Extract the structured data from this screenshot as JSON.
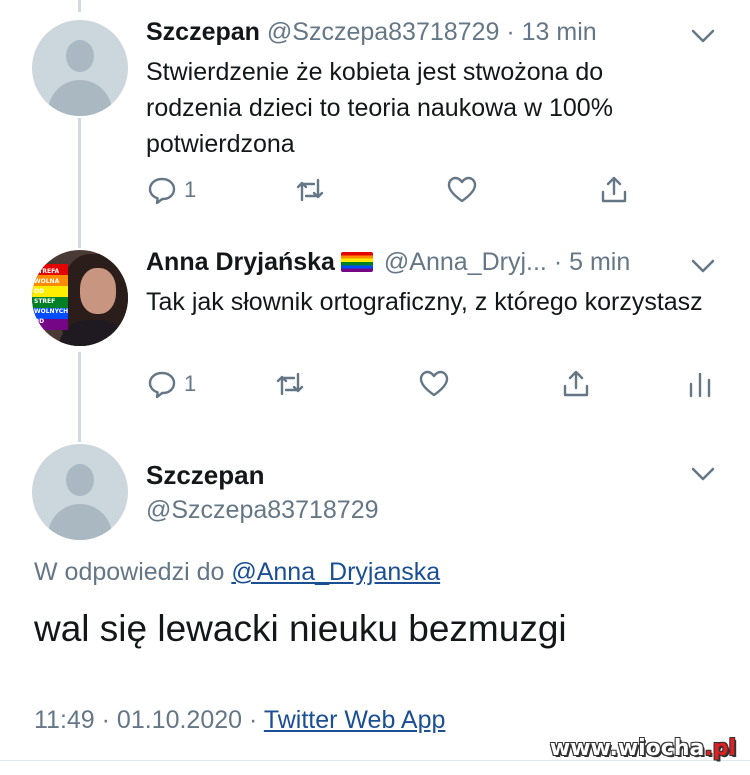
{
  "tweet1": {
    "name": "Szczepan",
    "handle": "@Szczepa83718729",
    "separator": "·",
    "time": "13 min",
    "text": "Stwierdzenie że kobieta jest stwożona do rodzenia dzieci to teoria naukowa w 100% potwierdzona",
    "reply_count": "1"
  },
  "tweet2": {
    "name": "Anna Dryjańska",
    "handle": "@Anna_Dryj...",
    "separator": "·",
    "time": "5 min",
    "text": "Tak jak słownik ortograficzny, z którego korzystasz",
    "reply_count": "1",
    "avatar_flag_lines": [
      "STREFA",
      "WOLNA",
      "OD",
      "STREF",
      "WOLNYCH",
      "OD"
    ]
  },
  "main_tweet": {
    "name": "Szczepan",
    "handle": "@Szczepa83718729",
    "reply_prefix": "W odpowiedzi do",
    "reply_to": "@Anna_Dryjanska",
    "text": "wal się lewacki nieuku bezmuzgi",
    "time": "11:49 · 01.10.2020",
    "separator": "·",
    "source": "Twitter Web App"
  },
  "watermark": {
    "main": "www.wiocha",
    "tld": ".pl"
  },
  "colors": {
    "text": "#14171a",
    "muted": "#657786",
    "link": "#1b4f94",
    "thread_line": "#cfd9de"
  }
}
